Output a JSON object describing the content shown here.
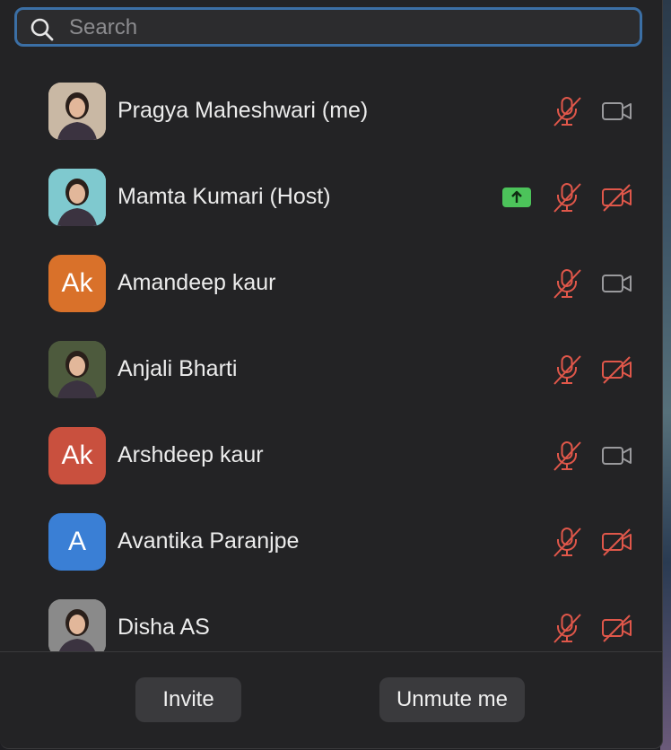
{
  "search": {
    "placeholder": "Search",
    "value": ""
  },
  "colors": {
    "panel_bg": "#232325",
    "muted_red": "#e0574a",
    "camera_on_gray": "#9a9a9d",
    "share_green": "#4cc35a",
    "search_focus_border": "#3b6fa5",
    "button_bg": "#3a3a3d"
  },
  "participants": [
    {
      "name": "Pragya Maheshwari (me)",
      "avatar_type": "photo",
      "avatar_icon": "person-photo",
      "avatar_color": "#c9b8a4",
      "mic": "muted",
      "camera": "off-gray",
      "screen_share": false
    },
    {
      "name": "Mamta Kumari (Host)",
      "avatar_type": "photo",
      "avatar_icon": "person-photo",
      "avatar_color": "#7fc9cf",
      "mic": "muted",
      "camera": "off-red",
      "screen_share": true
    },
    {
      "name": "Amandeep kaur",
      "avatar_type": "initials",
      "initials": "Ak",
      "avatar_color": "#d9712a",
      "mic": "muted",
      "camera": "off-gray",
      "screen_share": false
    },
    {
      "name": "Anjali Bharti",
      "avatar_type": "photo",
      "avatar_icon": "person-photo",
      "avatar_color": "#4d5a3d",
      "mic": "muted",
      "camera": "off-red",
      "screen_share": false
    },
    {
      "name": "Arshdeep kaur",
      "avatar_type": "initials",
      "initials": "Ak",
      "avatar_color": "#c9503e",
      "mic": "muted",
      "camera": "off-gray",
      "screen_share": false
    },
    {
      "name": "Avantika Paranjpe",
      "avatar_type": "initials",
      "initials": "A",
      "avatar_color": "#3a7fd5",
      "mic": "muted",
      "camera": "off-red",
      "screen_share": false
    },
    {
      "name": "Disha AS",
      "avatar_type": "photo",
      "avatar_icon": "person-photo",
      "avatar_color": "#8a8a8a",
      "mic": "muted",
      "camera": "off-red",
      "screen_share": false
    }
  ],
  "footer": {
    "invite_label": "Invite",
    "unmute_label": "Unmute me"
  }
}
